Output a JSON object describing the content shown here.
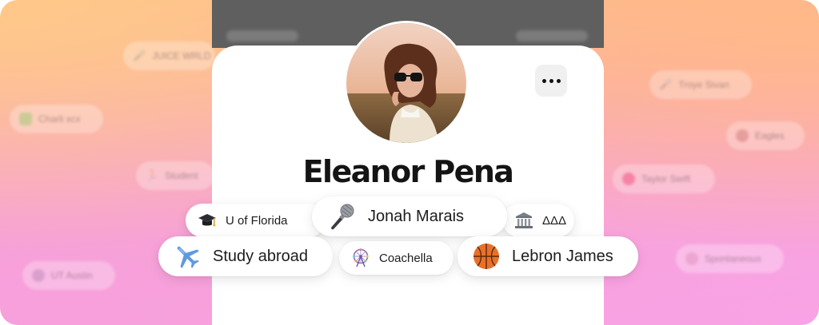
{
  "profile": {
    "name": "Eleanor Pena",
    "more_icon": "ellipsis-icon"
  },
  "tags": [
    {
      "label": "U of Florida",
      "icon": "graduation-cap-icon"
    },
    {
      "label": "Jonah Marais",
      "icon": "microphone-icon"
    },
    {
      "label": "ΔΔΔ",
      "icon": "classical-building-icon"
    },
    {
      "label": "Study abroad",
      "icon": "airplane-icon"
    },
    {
      "label": "Coachella",
      "icon": "ferris-wheel-icon"
    },
    {
      "label": "Lebron James",
      "icon": "basketball-icon"
    }
  ],
  "background_tags": [
    {
      "label": "JUICE WRLD",
      "icon": "microphone-icon"
    },
    {
      "label": "Charli xcx",
      "icon": "music-icon"
    },
    {
      "label": "Student",
      "icon": "person-icon"
    },
    {
      "label": "UT Austin",
      "icon": "chat-icon"
    },
    {
      "label": "Troye Sivan",
      "icon": "microphone-icon"
    },
    {
      "label": "Eagles",
      "icon": "football-icon"
    },
    {
      "label": "Taylor Swift",
      "icon": "heart-icon"
    },
    {
      "label": "Spontaneous",
      "icon": "sparkle-icon"
    }
  ],
  "colors": {
    "background_top": "#ffc98a",
    "background_bottom": "#f59fdc",
    "card": "#ffffff",
    "text": "#141414"
  }
}
